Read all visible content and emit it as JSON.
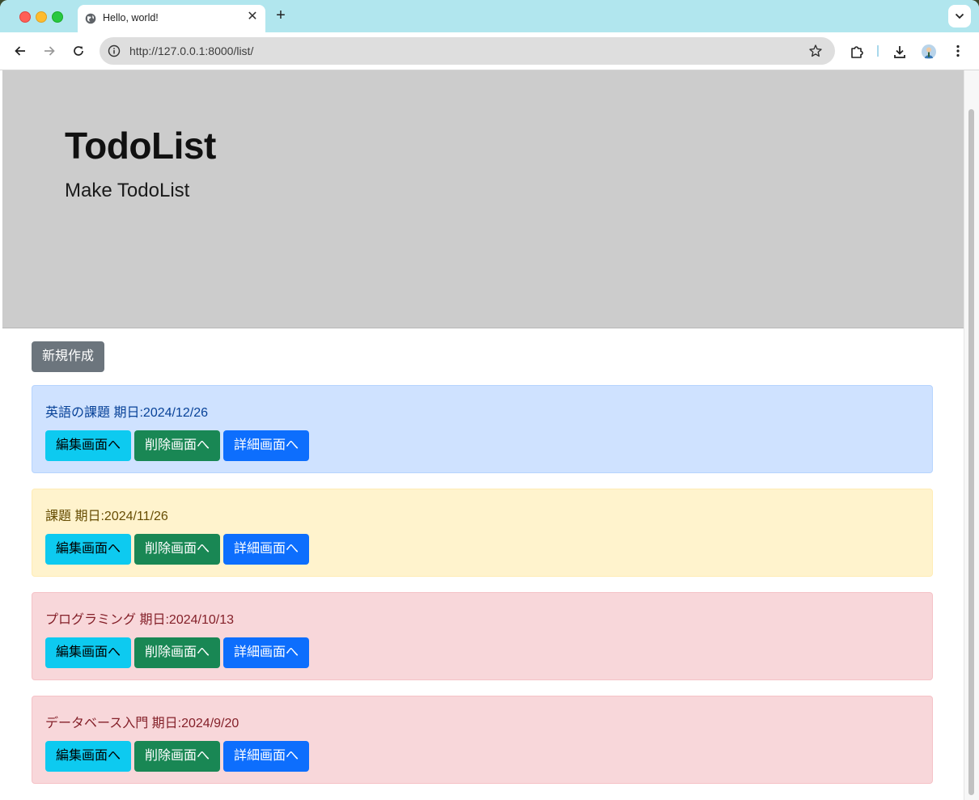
{
  "browser": {
    "tab_title": "Hello, world!",
    "url": "http://127.0.0.1:8000/list/"
  },
  "hero": {
    "title": "TodoList",
    "lead": "Make TodoList"
  },
  "actions": {
    "new_label": "新規作成"
  },
  "todos": [
    {
      "name": "英語の課題",
      "due": "期日:2024/12/26",
      "bg": "#cfe2ff",
      "border": "#b6d4fe",
      "text_color": "#084298"
    },
    {
      "name": "課題",
      "due": "期日:2024/11/26",
      "bg": "#fff3cd",
      "border": "#ffecb5",
      "text_color": "#664d03"
    },
    {
      "name": "プログラミング",
      "due": "期日:2024/10/13",
      "bg": "#f8d7da",
      "border": "#f5c2c7",
      "text_color": "#842029"
    },
    {
      "name": "データベース入門",
      "due": "期日:2024/9/20",
      "bg": "#f8d7da",
      "border": "#f5c2c7",
      "text_color": "#842029"
    }
  ],
  "buttons": {
    "edit": "編集画面へ",
    "delete": "削除画面へ",
    "detail": "詳細画面へ"
  }
}
